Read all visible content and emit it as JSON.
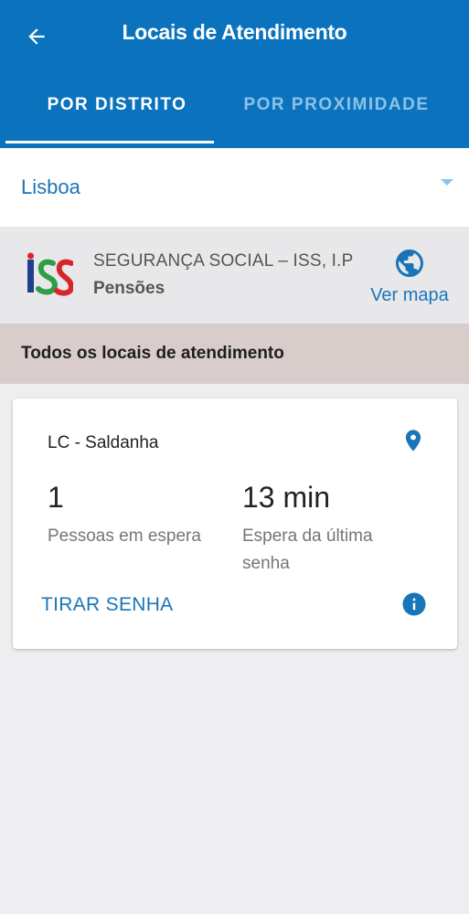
{
  "header": {
    "title": "Locais de Atendimento",
    "back_icon": "arrow-left-icon"
  },
  "tabs": [
    {
      "label": "POR DISTRITO",
      "selected": true
    },
    {
      "label": "POR PROXIMIDADE",
      "selected": false
    }
  ],
  "district": {
    "selected": "Lisboa",
    "icon": "chevron-down-icon"
  },
  "service": {
    "organization": "SEGURANÇA SOCIAL – ISS, I.P",
    "name": "Pensões",
    "logo_icon": "iss-logo",
    "map_label": "Ver mapa",
    "map_icon": "globe-icon"
  },
  "section": {
    "title": "Todos os locais de atendimento"
  },
  "locations": [
    {
      "name": "LC - Saldanha",
      "people_waiting": "1",
      "people_label": "Pessoas em espera",
      "last_wait": "13 min",
      "last_wait_label_line1": "Espera da última",
      "last_wait_label_line2": "senha",
      "action_label": "TIRAR SENHA",
      "pin_icon": "location-pin-icon",
      "info_icon": "info-icon"
    }
  ],
  "colors": {
    "primary": "#0b73bd",
    "accent": "#1a75b8",
    "tab_inactive": "#8cc2e8",
    "section_bg": "#d8cdcb",
    "background": "#eeeef0"
  }
}
